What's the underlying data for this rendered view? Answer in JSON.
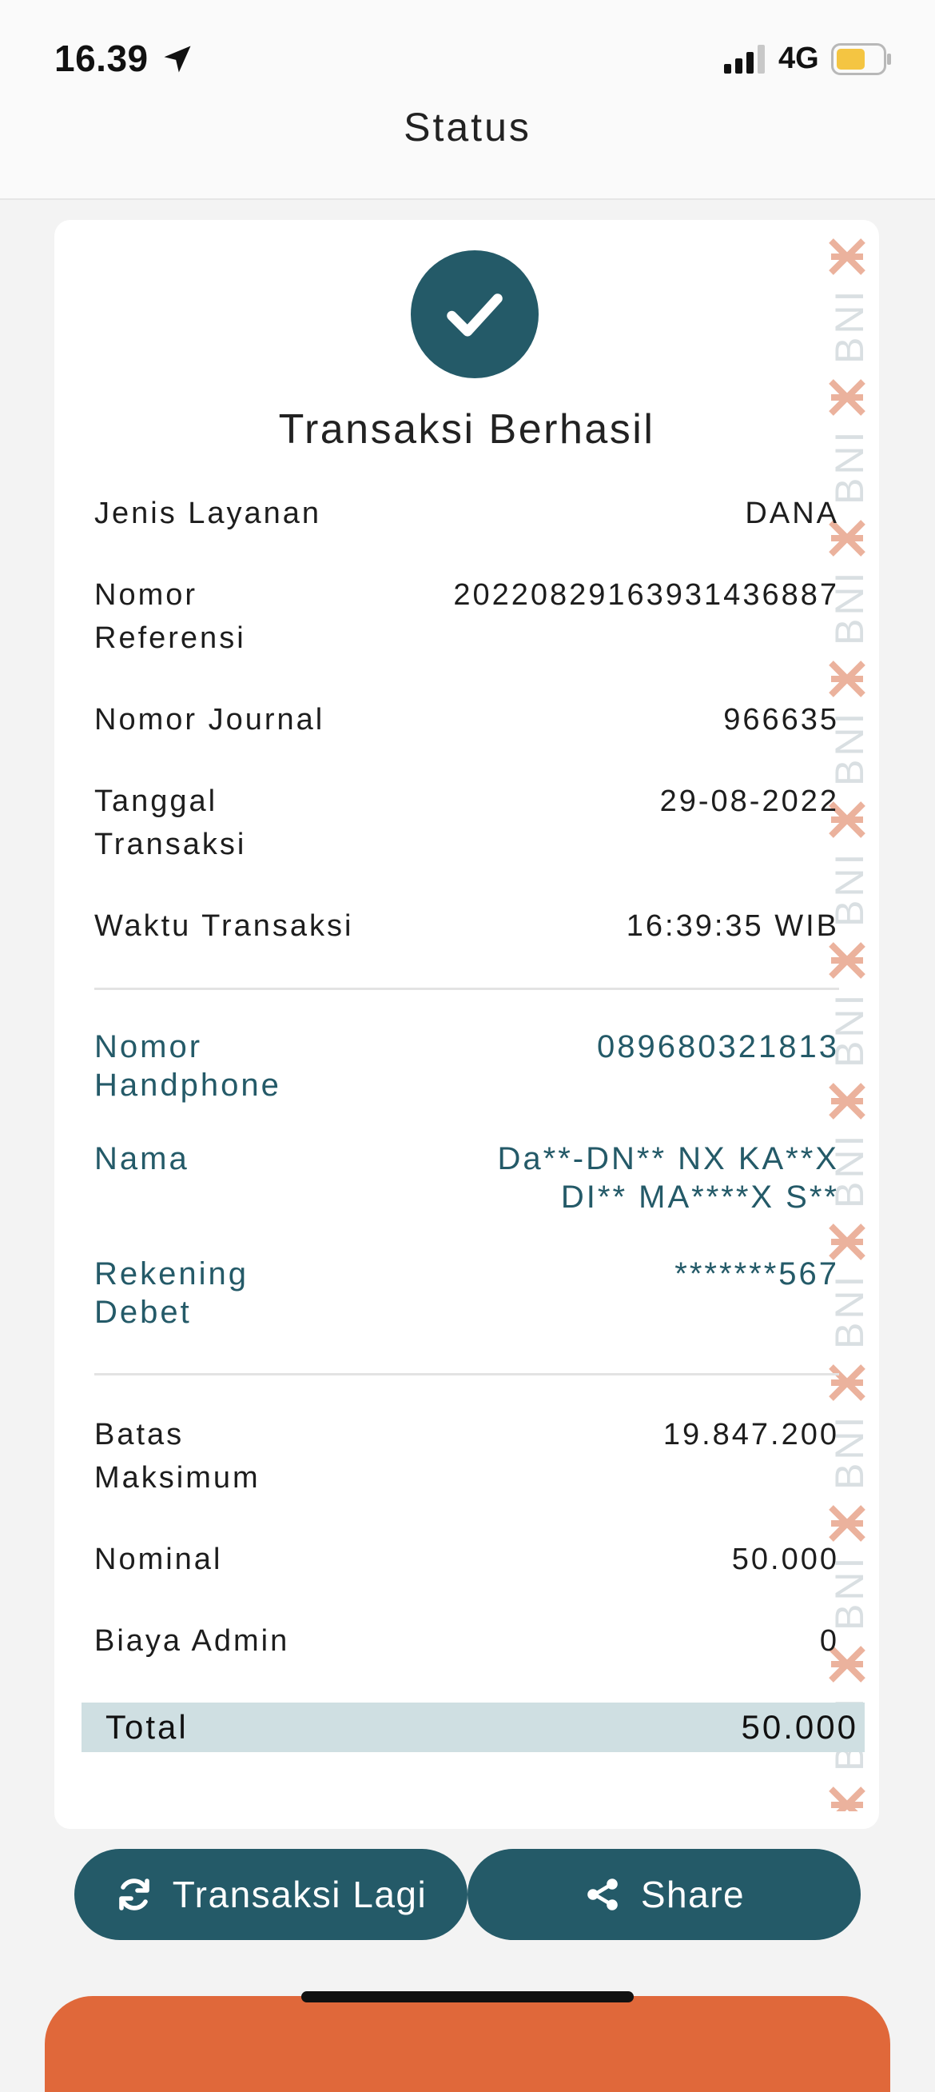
{
  "status_bar": {
    "time": "16.39",
    "network": "4G",
    "battery_color": "#f4c542"
  },
  "nav": {
    "title": "Status"
  },
  "receipt": {
    "status_title": "Transaksi Berhasil",
    "watermark_text": "BNI",
    "rows": [
      {
        "label": "Jenis Layanan",
        "value": "DANA"
      },
      {
        "label": "Nomor Referensi",
        "value": "20220829163931436887"
      },
      {
        "label": "Nomor Journal",
        "value": "966635"
      },
      {
        "label": "Tanggal Transaksi",
        "value": "29-08-2022"
      },
      {
        "label": "Waktu Transaksi",
        "value": "16:39:35 WIB"
      }
    ],
    "customer": [
      {
        "label": "Nomor Handphone",
        "value": "089680321813"
      },
      {
        "label": "Nama",
        "value": "Da**-DN** NX KA**X DI** MA****X S**"
      },
      {
        "label": "Rekening Debet",
        "value": "*******567"
      }
    ],
    "amounts": [
      {
        "label": "Batas Maksimum",
        "value": "19.847.200"
      },
      {
        "label": "Nominal",
        "value": "50.000"
      },
      {
        "label": "Biaya Admin",
        "value": "0"
      }
    ],
    "total": {
      "label": "Total",
      "value": "50.000"
    }
  },
  "actions": {
    "again_label": "Transaksi Lagi",
    "share_label": "Share"
  },
  "colors": {
    "primary": "#245a68",
    "total_bg": "#cfdfe2",
    "watermark": "#e8a58c",
    "bottom_bar": "#e0683a"
  }
}
